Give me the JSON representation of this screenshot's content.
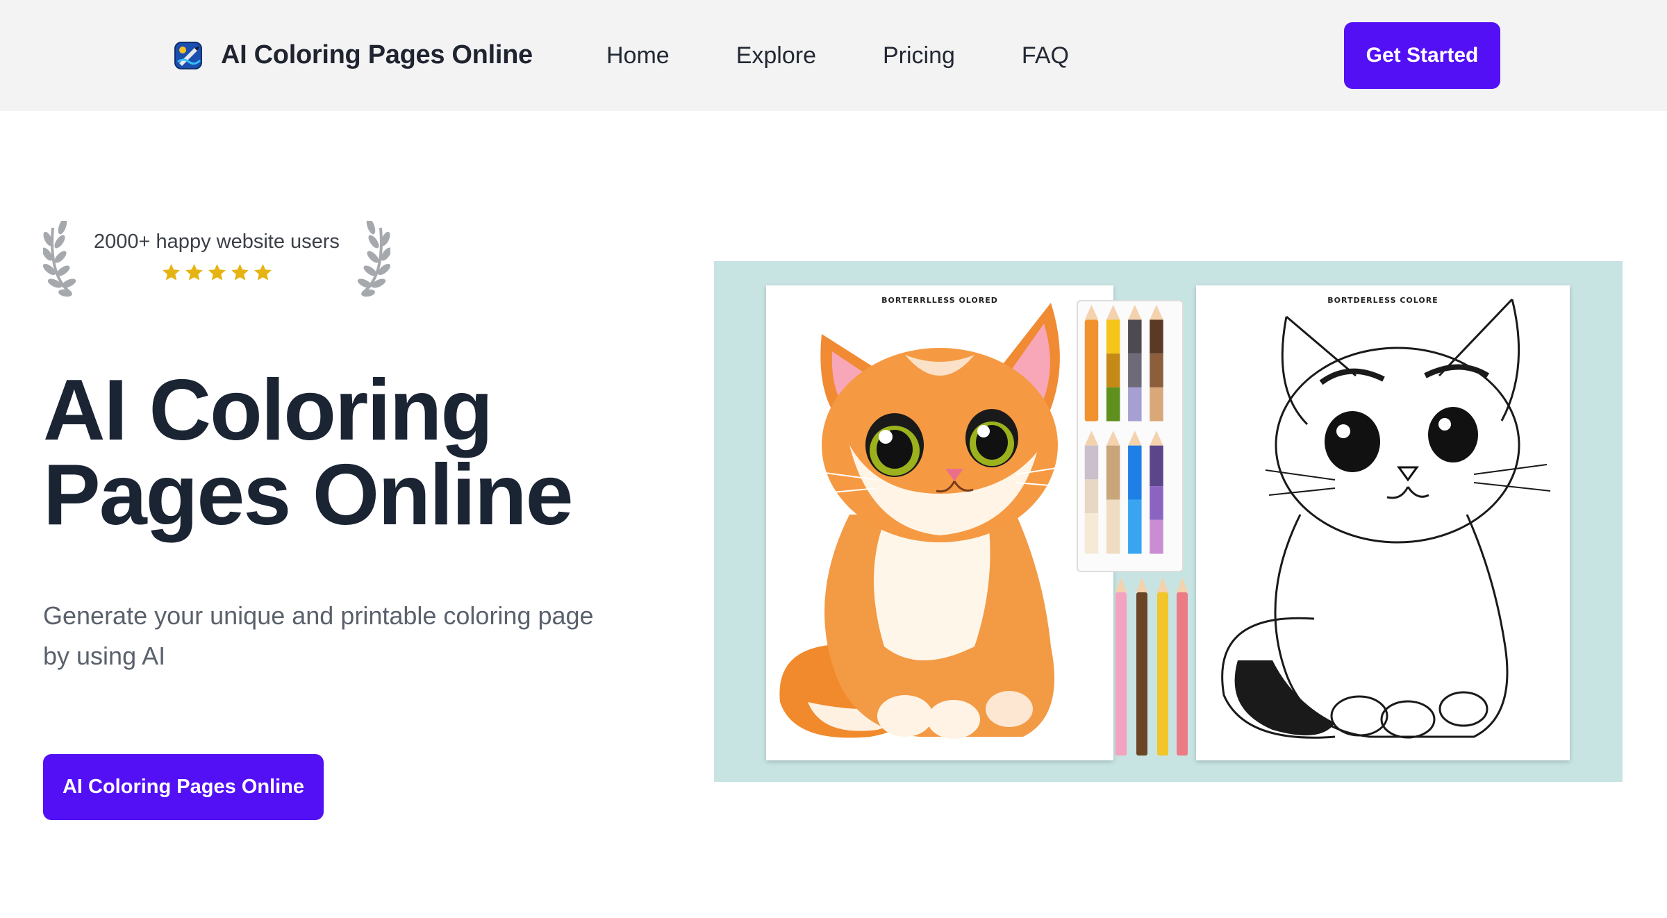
{
  "nav": {
    "brand": "AI Coloring Pages Online",
    "links": [
      "Home",
      "Explore",
      "Pricing",
      "FAQ"
    ],
    "cta": "Get Started"
  },
  "proof": {
    "text": "2000+ happy website users",
    "rating": 5
  },
  "hero": {
    "title_line1": "AI Coloring",
    "title_line2": "Pages Online",
    "subtitle": "Generate your unique and printable coloring page by using AI",
    "cta": "AI Coloring Pages Online"
  },
  "image": {
    "left_label": "BORTERRLLESS OLORED",
    "right_label": "BORTDERLESS COLORE"
  },
  "colors": {
    "accent": "#5310f5",
    "star": "#e5b412",
    "image_bg": "#c7e4e2"
  }
}
